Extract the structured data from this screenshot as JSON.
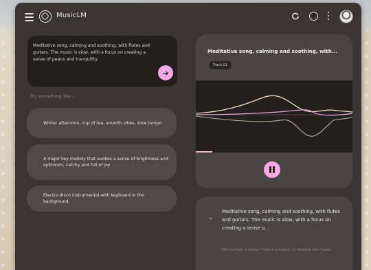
{
  "app": {
    "title": "MusicLM"
  },
  "icons": {
    "menu": "menu-icon",
    "logo": "musiclm-logo-icon",
    "refresh": "refresh-icon",
    "help": "help-icon",
    "more": "more-vert-icon",
    "send": "arrow-right-icon",
    "pause": "pause-icon",
    "chevron": "chevron-down-icon",
    "help_glyph": "?",
    "send_glyph": "➔",
    "chevron_glyph": "⌄"
  },
  "prompt": {
    "text": "Meditative song, calming and soothing, with flutes and guitars. The music is slow, with a focus on creating a sense of peace and tranquility."
  },
  "suggestions": {
    "label": "Try something like...",
    "items": [
      "Winter afternoon, cup of tea, smooth vibes, slow tempo",
      "A major key melody that evokes a sense of brightness and optimism, catchy and full of joy",
      "Electro-disco instrumental with keyboard in the background"
    ]
  },
  "player": {
    "title": "Meditative song, calming and soothing, with...",
    "track": "Track 01",
    "progress": 0.1
  },
  "description": {
    "text": "Meditative song, calming and soothing, with flutes and guitars. The music is slow, with a focus on creating a sense o...",
    "hint": "Which track is better? Give it a trophy, to improve the model."
  },
  "colors": {
    "accent": "#f6a9e4",
    "surface": "#3a3533",
    "card": "#4a4542",
    "wave_pink": "#e9a3d6",
    "wave_cream": "#efe2c2"
  }
}
